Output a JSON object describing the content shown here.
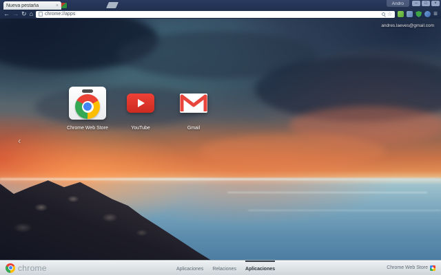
{
  "window": {
    "profile_name": "Andro",
    "controls": {
      "minimize": "–",
      "maximize": "□",
      "close": "×"
    }
  },
  "tab_strip": {
    "active_tab": {
      "title": "Nueva pestaña",
      "close_glyph": "×"
    }
  },
  "toolbar": {
    "back_glyph": "←",
    "forward_glyph": "→",
    "reload_glyph": "↻",
    "home_glyph": "⌂",
    "url": "chrome://apps",
    "bookmark_star_glyph": "☆",
    "menu_glyph": "≡"
  },
  "content": {
    "account_email": "andres.laeves@gmail.com",
    "prev_page_glyph": "‹",
    "apps": [
      {
        "label": "Chrome Web Store"
      },
      {
        "label": "YouTube"
      },
      {
        "label": "Gmail"
      }
    ]
  },
  "footer": {
    "brand": "chrome",
    "nav": [
      {
        "label": "Aplicaciones",
        "selected": false
      },
      {
        "label": "Relaciones",
        "selected": false
      },
      {
        "label": "Aplicaciones",
        "selected": true
      }
    ],
    "store_link": "Chrome Web Store"
  },
  "colors": {
    "theme_frame": "#20304f",
    "sunset_orange": "#e08a52",
    "sea_blue": "#5d8dad",
    "accent_red": "#ea4335",
    "accent_green": "#34a853",
    "accent_yellow": "#fbbc05",
    "accent_blue": "#4285f4"
  }
}
